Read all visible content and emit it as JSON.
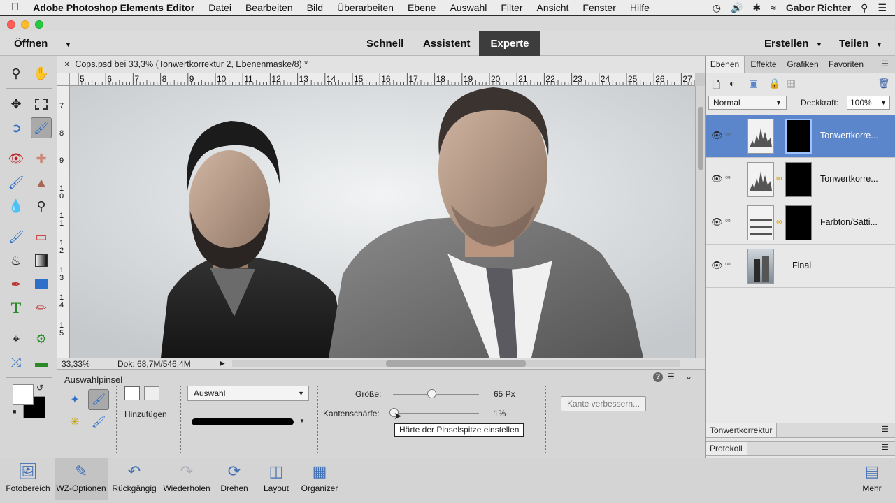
{
  "menubar": {
    "app_name": "Adobe Photoshop Elements Editor",
    "items": [
      "Datei",
      "Bearbeiten",
      "Bild",
      "Überarbeiten",
      "Ebene",
      "Auswahl",
      "Filter",
      "Ansicht",
      "Fenster",
      "Hilfe"
    ],
    "user": "Gabor Richter"
  },
  "modebar": {
    "open_label": "Öffnen",
    "modes": [
      "Schnell",
      "Assistent",
      "Experte"
    ],
    "active_mode": "Experte",
    "create_label": "Erstellen",
    "share_label": "Teilen"
  },
  "document": {
    "tab_title": "Cops.psd bei 33,3% (Tonwertkorrektur 2, Ebenenmaske/8) *",
    "close_glyph": "×",
    "ruler_h": [
      "5",
      "6",
      "7",
      "8",
      "9",
      "10",
      "11",
      "12",
      "13",
      "14",
      "15",
      "16",
      "17",
      "18",
      "19",
      "20",
      "21",
      "22",
      "23",
      "24",
      "25",
      "26",
      "27"
    ],
    "ruler_v": [
      "7",
      "8",
      "9",
      "1 0",
      "1 1",
      "1 2",
      "1 3",
      "1 4",
      "1 5"
    ],
    "zoom": "33,33%",
    "doc_size": "Dok: 68,7M/546,4M"
  },
  "options": {
    "tool_name": "Auswahlpinsel",
    "mode_label": "Hinzufügen",
    "mode_select": "Auswahl",
    "size_label": "Größe:",
    "size_value": "65 Px",
    "size_level": 0.45,
    "hardness_label": "Kantenschärfe:",
    "hardness_value": "1%",
    "hardness_level": 0.01,
    "tooltip": "Härte der Pinselspitze einstellen",
    "refine_button": "Kante verbessern..."
  },
  "panel": {
    "tabs": [
      "Ebenen",
      "Effekte",
      "Grafiken",
      "Favoriten"
    ],
    "active_tab": "Ebenen",
    "blend_mode": "Normal",
    "opacity_label": "Deckkraft:",
    "opacity_value": "100%",
    "layers": [
      {
        "name": "Tonwertkorre...",
        "selected": true
      },
      {
        "name": "Tonwertkorre...",
        "selected": false
      },
      {
        "name": "Farbton/Sätti...",
        "selected": false
      },
      {
        "name": "Final",
        "selected": false
      }
    ],
    "collapsed_panels": [
      "Tonwertkorrektur",
      "Protokoll"
    ]
  },
  "bottombar": {
    "items": [
      "Fotobereich",
      "WZ-Optionen",
      "Rückgängig",
      "Wiederholen",
      "Drehen",
      "Layout",
      "Organizer"
    ],
    "more_label": "Mehr"
  },
  "colors": {
    "accent": "#5b86cc",
    "mode_active_bg": "#3d3d3d",
    "link_gold": "#d79b00"
  }
}
